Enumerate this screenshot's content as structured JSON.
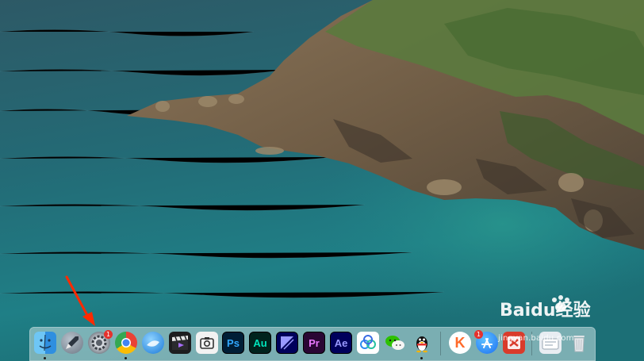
{
  "desktop": {
    "wallpaper": "coastal-cliff-sea-photo"
  },
  "dock": {
    "apps": [
      {
        "name": "Finder",
        "icon": "finder-icon"
      },
      {
        "name": "Launchpad",
        "icon": "rocket-icon"
      },
      {
        "name": "System Preferences",
        "icon": "gear-icon",
        "badge": "1"
      },
      {
        "name": "Chrome",
        "icon": "chrome-icon"
      },
      {
        "name": "Browser",
        "icon": "browser-icon"
      },
      {
        "name": "Final Cut Pro",
        "icon": "clapperboard-icon"
      },
      {
        "name": "Screenshot",
        "icon": "camera-icon"
      },
      {
        "name": "Photoshop",
        "label": "Ps",
        "color": "#31a8ff"
      },
      {
        "name": "Audition",
        "label": "Au",
        "color": "#00e4bb"
      },
      {
        "name": "Media Encoder",
        "label": "",
        "color": "#9999ff"
      },
      {
        "name": "Premiere Pro",
        "label": "Pr",
        "color": "#ea77ff"
      },
      {
        "name": "After Effects",
        "label": "Ae",
        "color": "#9999ff"
      },
      {
        "name": "Baidu Netdisk",
        "icon": "cloud-icon"
      },
      {
        "name": "WeChat",
        "icon": "wechat-icon"
      },
      {
        "name": "QQ",
        "icon": "penguin-icon"
      },
      {
        "name": "K",
        "label": "K",
        "icon": "k-icon"
      },
      {
        "name": "App Store",
        "icon": "app-store-icon",
        "badge": "1"
      },
      {
        "name": "App",
        "icon": "red-app-icon"
      },
      {
        "name": "Downloads",
        "icon": "folder-icon"
      },
      {
        "name": "Trash",
        "icon": "trash-icon"
      }
    ]
  },
  "watermark": {
    "brand": "Baidu经验",
    "url": "jingyan.baidu.com"
  },
  "annotation": {
    "arrow_color": "#ff2a00"
  }
}
